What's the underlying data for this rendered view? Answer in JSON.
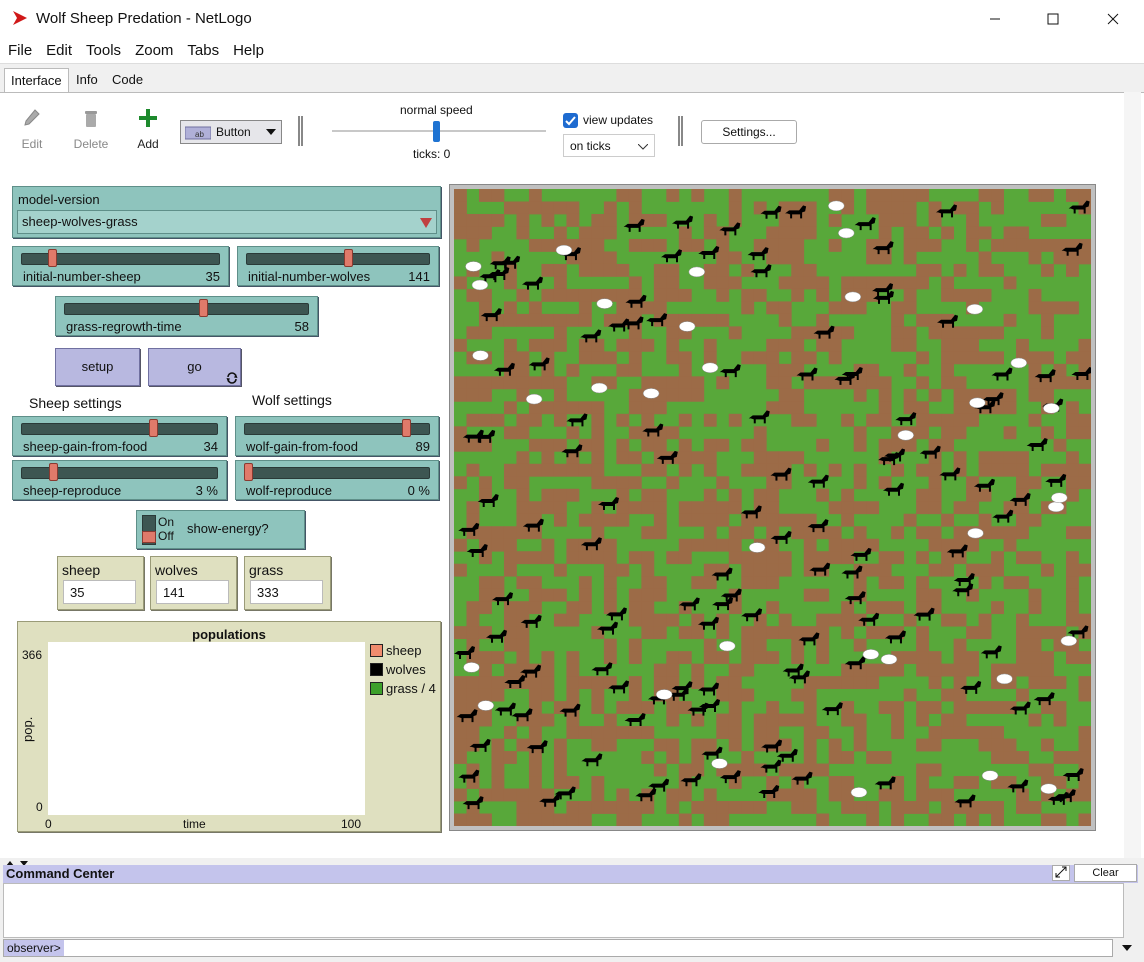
{
  "window": {
    "title": "Wolf Sheep Predation - NetLogo"
  },
  "menu": [
    "File",
    "Edit",
    "Tools",
    "Zoom",
    "Tabs",
    "Help"
  ],
  "tabs": [
    "Interface",
    "Info",
    "Code"
  ],
  "toolbar": {
    "edit_label": "Edit",
    "delete_label": "Delete",
    "add_label": "Add",
    "widget_type": "Button",
    "speed_label": "normal speed",
    "speed_fraction": 0.5,
    "ticks_text": "ticks: 0",
    "view_updates_label": "view updates",
    "view_updates_checked": true,
    "update_mode": "on ticks",
    "settings_label": "Settings..."
  },
  "chooser": {
    "name": "model-version",
    "value": "sheep-wolves-grass"
  },
  "sliders": {
    "initial_number_sheep": {
      "label": "initial-number-sheep",
      "value": "35",
      "fraction": 0.14
    },
    "initial_number_wolves": {
      "label": "initial-number-wolves",
      "value": "141",
      "fraction": 0.56
    },
    "grass_regrowth_time": {
      "label": "grass-regrowth-time",
      "value": "58",
      "fraction": 0.57
    },
    "sheep_gain_from_food": {
      "label": "sheep-gain-from-food",
      "value": "34",
      "fraction": 0.68
    },
    "wolf_gain_from_food": {
      "label": "wolf-gain-from-food",
      "value": "89",
      "fraction": 0.89
    },
    "sheep_reproduce": {
      "label": "sheep-reproduce",
      "value": "3 %",
      "fraction": 0.15
    },
    "wolf_reproduce": {
      "label": "wolf-reproduce",
      "value": "0 %",
      "fraction": 0.0
    }
  },
  "buttons": {
    "setup": "setup",
    "go": "go"
  },
  "section_labels": {
    "sheep": "Sheep settings",
    "wolf": "Wolf settings"
  },
  "switch": {
    "name": "show-energy?",
    "on_label": "On",
    "off_label": "Off",
    "state": "off"
  },
  "monitors": [
    {
      "name": "sheep",
      "value": "35"
    },
    {
      "name": "wolves",
      "value": "141"
    },
    {
      "name": "grass",
      "value": "333"
    }
  ],
  "plot": {
    "title": "populations",
    "y_max": "366",
    "y_min": "0",
    "x_min": "0",
    "x_max": "100",
    "xlabel": "time",
    "ylabel": "pop.",
    "legend": [
      {
        "name": "sheep",
        "color": "#f08c6e"
      },
      {
        "name": "wolves",
        "color": "#000000"
      },
      {
        "name": "grass / 4",
        "color": "#3da02a"
      }
    ]
  },
  "colors": {
    "grass": "#58a83a",
    "dirt": "#9c6b47",
    "wolf": "#000000",
    "sheep": "#ffffff"
  },
  "command_center": {
    "title": "Command Center",
    "clear_label": "Clear",
    "prompt": "observer>"
  }
}
